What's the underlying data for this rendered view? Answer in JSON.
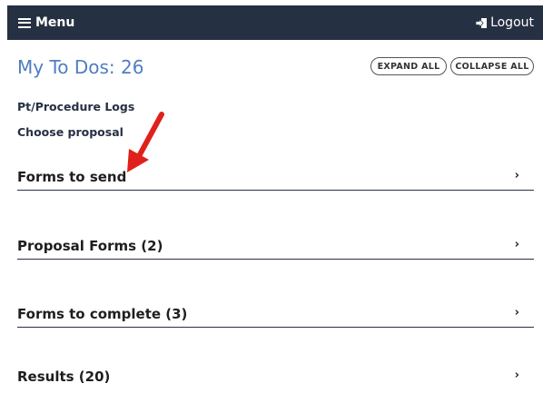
{
  "header": {
    "menu_label": "Menu",
    "logout_label": "Logout",
    "background_color": "#263043"
  },
  "title": "My To Dos: 26",
  "buttons": {
    "expand_all": "EXPAND ALL",
    "collapse_all": "COLLAPSE ALL"
  },
  "links": [
    {
      "label": "Pt/Procedure Logs"
    },
    {
      "label": "Choose proposal"
    }
  ],
  "sections": [
    {
      "label": "Forms to send"
    },
    {
      "label": "Proposal Forms (2)"
    },
    {
      "label": "Forms to complete (3)"
    },
    {
      "label": "Results (20)"
    }
  ],
  "annotation": {
    "type": "red-arrow",
    "color": "#e0201a",
    "points_to": "Forms to send"
  },
  "colors": {
    "title": "#4f7ec1",
    "text": "#263043"
  }
}
